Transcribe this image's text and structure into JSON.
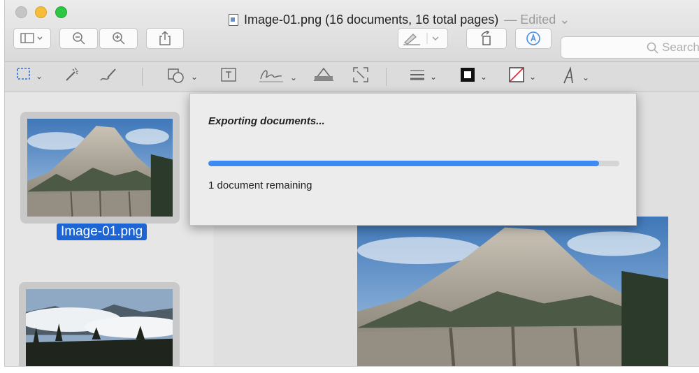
{
  "window": {
    "title": "Image-01.png (16 documents, 16 total pages)",
    "edited_label": "— Edited ⌄"
  },
  "search": {
    "placeholder": "Search"
  },
  "toolbar": {
    "icons": [
      "sidebar-icon",
      "zoom-out-icon",
      "zoom-in-icon",
      "share-icon",
      "highlight-icon",
      "rotate-icon",
      "markup-icon"
    ]
  },
  "markup_toolbar": {
    "icons": [
      "rectangular-selection-icon",
      "instant-alpha-icon",
      "sketch-icon",
      "shapes-icon",
      "text-icon",
      "sign-icon",
      "adjust-color-icon",
      "adjust-size-icon",
      "shape-style-icon",
      "border-color-icon",
      "fill-color-icon",
      "text-style-icon"
    ]
  },
  "sidebar": {
    "items": [
      {
        "label": "Image-01.png",
        "selected": true
      },
      {
        "label": "",
        "selected": false
      }
    ]
  },
  "export_sheet": {
    "title": "Exporting documents...",
    "status": "1 document remaining",
    "progress": 0.95
  },
  "colors": {
    "selection": "#1d64d4",
    "progress": "#3d8bf2",
    "minimize": "#f6bd3b",
    "zoom": "#2dc843"
  }
}
